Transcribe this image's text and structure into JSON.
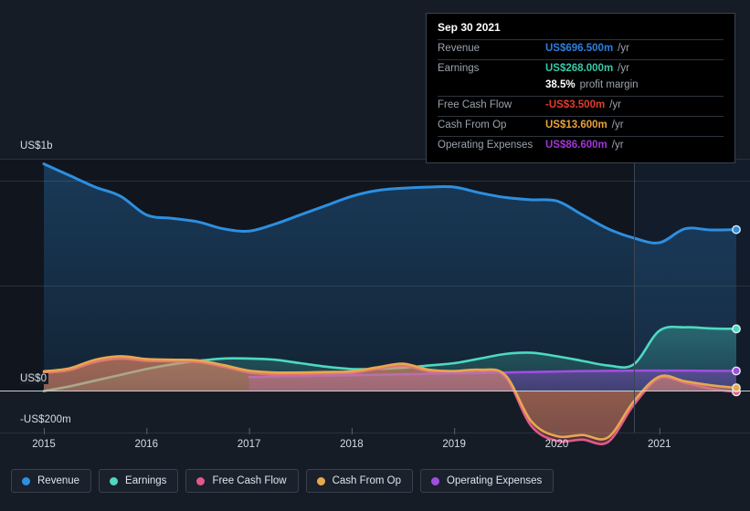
{
  "tooltip": {
    "date": "Sep 30 2021",
    "rows": [
      {
        "label": "Revenue",
        "value": "US$696.500m",
        "unit": "/yr",
        "color": "#2b7fe0"
      },
      {
        "label": "Earnings",
        "value": "US$268.000m",
        "unit": "/yr",
        "color": "#37c9a7"
      },
      {
        "label": "",
        "value": "38.5%",
        "unit": "profit margin",
        "color": "#ffffff",
        "sub": true
      },
      {
        "label": "Free Cash Flow",
        "value": "-US$3.500m",
        "unit": "/yr",
        "color": "#e23b2e"
      },
      {
        "label": "Cash From Op",
        "value": "US$13.600m",
        "unit": "/yr",
        "color": "#e8a33d"
      },
      {
        "label": "Operating Expenses",
        "value": "US$86.600m",
        "unit": "/yr",
        "color": "#a234d8"
      }
    ]
  },
  "axes": {
    "y_top": "US$1b",
    "y_zero": "US$0",
    "y_neg": "-US$200m",
    "x_ticks": [
      "2015",
      "2016",
      "2017",
      "2018",
      "2019",
      "2020",
      "2021"
    ]
  },
  "legend": [
    {
      "label": "Revenue",
      "color": "#2d8fe0"
    },
    {
      "label": "Earnings",
      "color": "#4dd9c0"
    },
    {
      "label": "Free Cash Flow",
      "color": "#e05a8a"
    },
    {
      "label": "Cash From Op",
      "color": "#e8a84d"
    },
    {
      "label": "Operating Expenses",
      "color": "#a24de0"
    }
  ],
  "chart_data": {
    "type": "area",
    "title": "",
    "xlabel": "",
    "ylabel": "",
    "ylim": [
      -200,
      1000
    ],
    "yunit": "US$ millions",
    "grid": true,
    "legend_position": "bottom",
    "x": [
      2015.0,
      2015.25,
      2015.5,
      2015.75,
      2016.0,
      2016.25,
      2016.5,
      2016.75,
      2017.0,
      2017.25,
      2017.5,
      2017.75,
      2018.0,
      2018.25,
      2018.5,
      2018.75,
      2019.0,
      2019.25,
      2019.5,
      2019.75,
      2020.0,
      2020.25,
      2020.5,
      2020.75,
      2021.0,
      2021.25,
      2021.5,
      2021.75
    ],
    "series": [
      {
        "name": "Revenue",
        "color": "#2d8fe0",
        "values": [
          980,
          930,
          880,
          840,
          760,
          745,
          730,
          700,
          690,
          720,
          760,
          800,
          840,
          865,
          875,
          880,
          880,
          855,
          835,
          825,
          820,
          760,
          700,
          660,
          640,
          700,
          695,
          696.5
        ]
      },
      {
        "name": "Earnings",
        "color": "#4dd9c0",
        "values": [
          0,
          20,
          45,
          70,
          95,
          115,
          130,
          140,
          140,
          135,
          120,
          105,
          95,
          95,
          100,
          110,
          120,
          140,
          160,
          165,
          150,
          130,
          110,
          115,
          260,
          275,
          270,
          268
        ]
      },
      {
        "name": "Free Cash Flow",
        "color": "#e05a8a",
        "values": [
          78,
          90,
          125,
          140,
          130,
          128,
          125,
          105,
          80,
          72,
          72,
          75,
          78,
          95,
          110,
          85,
          80,
          85,
          60,
          -150,
          -215,
          -210,
          -220,
          -60,
          55,
          35,
          10,
          -3.5
        ]
      },
      {
        "name": "Cash From Op",
        "color": "#e8a84d",
        "values": [
          85,
          98,
          135,
          150,
          138,
          135,
          132,
          112,
          88,
          80,
          80,
          82,
          85,
          102,
          118,
          92,
          86,
          92,
          68,
          -130,
          -195,
          -190,
          -200,
          -45,
          62,
          42,
          25,
          13.6
        ]
      },
      {
        "name": "Operating Expenses",
        "color": "#a24de0",
        "start_index": 8,
        "values": [
          null,
          null,
          null,
          null,
          null,
          null,
          null,
          null,
          60,
          62,
          64,
          66,
          68,
          70,
          72,
          74,
          76,
          78,
          80,
          82,
          84,
          86,
          87,
          88,
          88,
          88,
          87,
          86.6
        ]
      }
    ],
    "annotations": [
      {
        "type": "vline",
        "x": 2020.85,
        "note": "estimate boundary"
      },
      {
        "type": "endpoint-markers",
        "x": 2021.75
      }
    ]
  }
}
